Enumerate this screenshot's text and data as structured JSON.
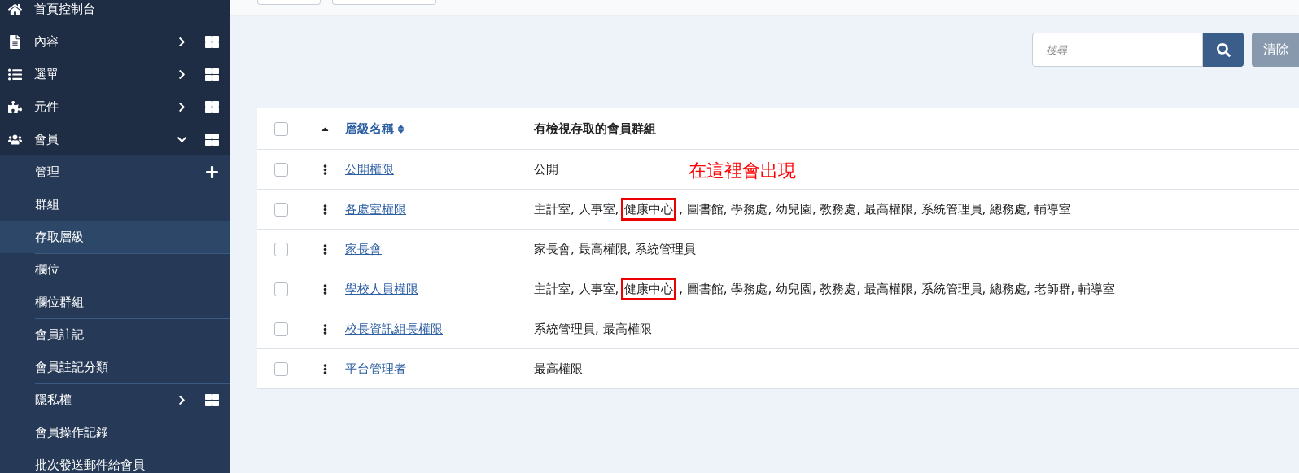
{
  "sidebar": {
    "items": [
      {
        "label": "首頁控制台",
        "kind": "link"
      },
      {
        "label": "內容",
        "kind": "menu",
        "expanded": false
      },
      {
        "label": "選單",
        "kind": "menu",
        "expanded": false
      },
      {
        "label": "元件",
        "kind": "menu",
        "expanded": false
      },
      {
        "label": "會員",
        "kind": "menu",
        "expanded": true,
        "children": [
          {
            "label": "管理",
            "kind": "add",
            "selected": false,
            "separated": false
          },
          {
            "label": "群組",
            "kind": "link",
            "selected": false,
            "separated": false
          },
          {
            "label": "存取層級",
            "kind": "link",
            "selected": true,
            "separated": false
          },
          {
            "label": "欄位",
            "kind": "link",
            "selected": false,
            "separated": true
          },
          {
            "label": "欄位群組",
            "kind": "link",
            "selected": false,
            "separated": false
          },
          {
            "label": "會員註記",
            "kind": "link",
            "selected": false,
            "separated": true
          },
          {
            "label": "會員註記分類",
            "kind": "link",
            "selected": false,
            "separated": false
          },
          {
            "label": "隱私權",
            "kind": "menu",
            "expanded": false,
            "selected": false,
            "separated": true
          },
          {
            "label": "會員操作記錄",
            "kind": "link",
            "selected": false,
            "separated": false
          },
          {
            "label": "批次發送郵件給會員",
            "kind": "link",
            "selected": false,
            "separated": true
          }
        ]
      }
    ]
  },
  "search": {
    "placeholder": "搜尋",
    "clear_button": "清除"
  },
  "table": {
    "all_checked": false,
    "columns": [
      {
        "label": "層級名稱",
        "sortable": true
      },
      {
        "label": "有檢視存取的會員群組",
        "sortable": false
      }
    ],
    "rows": [
      {
        "name": "公開權限",
        "checked": false,
        "groups": [
          {
            "text": "公開",
            "highlighted": false
          }
        ]
      },
      {
        "name": "各處室權限",
        "checked": false,
        "groups": [
          {
            "text": "主計室, 人事室,",
            "highlighted": false
          },
          {
            "text": "健康中心",
            "highlighted": true
          },
          {
            "text": ", 圖書館, 學務處, 幼兒園, 教務處, 最高權限, 系統管理員, 總務處, 輔導室",
            "highlighted": false
          }
        ]
      },
      {
        "name": "家長會",
        "checked": false,
        "groups": [
          {
            "text": "家長會, 最高權限, 系統管理員",
            "highlighted": false
          }
        ]
      },
      {
        "name": "學校人員權限",
        "checked": false,
        "groups": [
          {
            "text": "主計室, 人事室,",
            "highlighted": false
          },
          {
            "text": "健康中心",
            "highlighted": true
          },
          {
            "text": ", 圖書館, 學務處, 幼兒園, 教務處, 最高權限, 系統管理員, 總務處, 老師群, 輔導室",
            "highlighted": false
          }
        ]
      },
      {
        "name": "校長資訊組長權限",
        "checked": false,
        "groups": [
          {
            "text": "系統管理員, 最高權限",
            "highlighted": false
          }
        ]
      },
      {
        "name": "平台管理者",
        "checked": false,
        "groups": [
          {
            "text": "最高權限",
            "highlighted": false
          }
        ]
      }
    ]
  },
  "annotation": "在這裡會出現"
}
